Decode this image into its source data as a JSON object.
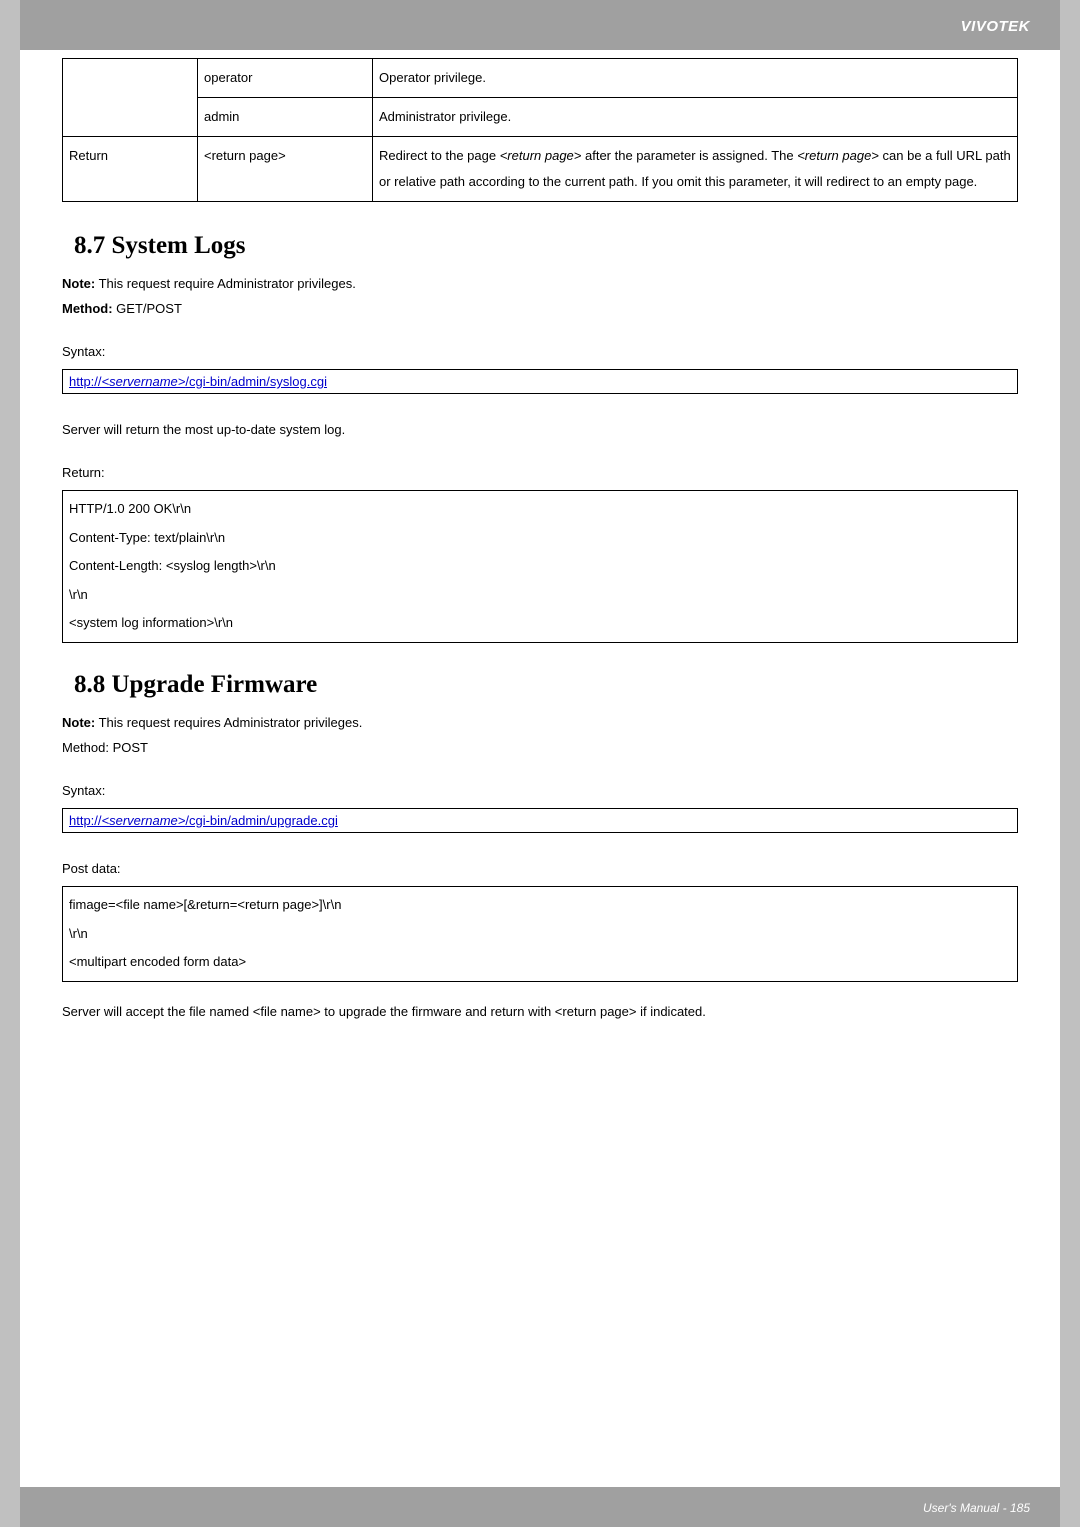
{
  "header": {
    "brand": "VIVOTEK"
  },
  "table1": {
    "r1c1": "",
    "r1c2": "operator",
    "r1c3": "Operator privilege.",
    "r2c1": "",
    "r2c2": "admin",
    "r2c3": "Administrator privilege.",
    "r3c1": "Return",
    "r3c2": "<return page>",
    "r3pre": "Redirect to the page ",
    "r3it1": "<return page>",
    "r3mid1": " after the parameter is assigned. The ",
    "r3it2": "<return page>",
    "r3post": " can be a full URL path or relative path according to the current path. If you omit this parameter, it will redirect to an empty page."
  },
  "s87": {
    "heading": "8.7 System Logs",
    "noteLabel": "Note:",
    "noteText": " This request require Administrator privileges.",
    "methodLabel": "Method:",
    "methodText": " GET/POST",
    "syntaxLabel": "Syntax:",
    "url_p1": "http://",
    "url_p2": "<servername>",
    "url_p3": "/cgi-bin/admin/syslog.cgi",
    "afterSyntax": "Server will return the most up-to-date system log.",
    "returnLabel": "Return:",
    "ret1": "HTTP/1.0 200 OK\\r\\n",
    "ret2": "Content-Type: text/plain\\r\\n",
    "ret3": "Content-Length: <syslog length>\\r\\n",
    "ret4": "\\r\\n",
    "ret5": "<system log information>\\r\\n"
  },
  "s88": {
    "heading": "8.8 Upgrade Firmware",
    "noteLabel": "Note:",
    "noteText": " This request requires Administrator privileges.",
    "methodLine": "Method: POST",
    "syntaxLabel": "Syntax:",
    "url_p1": "http://",
    "url_p2": "<servername>",
    "url_p3": "/cgi-bin/admin/upgrade.cgi",
    "postDataLabel": "Post data:",
    "pd1": "fimage=<file name>[&return=<return page>]\\r\\n",
    "pd2": "\\r\\n",
    "pd3": "<multipart encoded form data>",
    "afterPost": "Server will accept the file named <file name> to upgrade the firmware and return with <return page> if indicated."
  },
  "footer": {
    "text": "User's Manual - 185"
  }
}
